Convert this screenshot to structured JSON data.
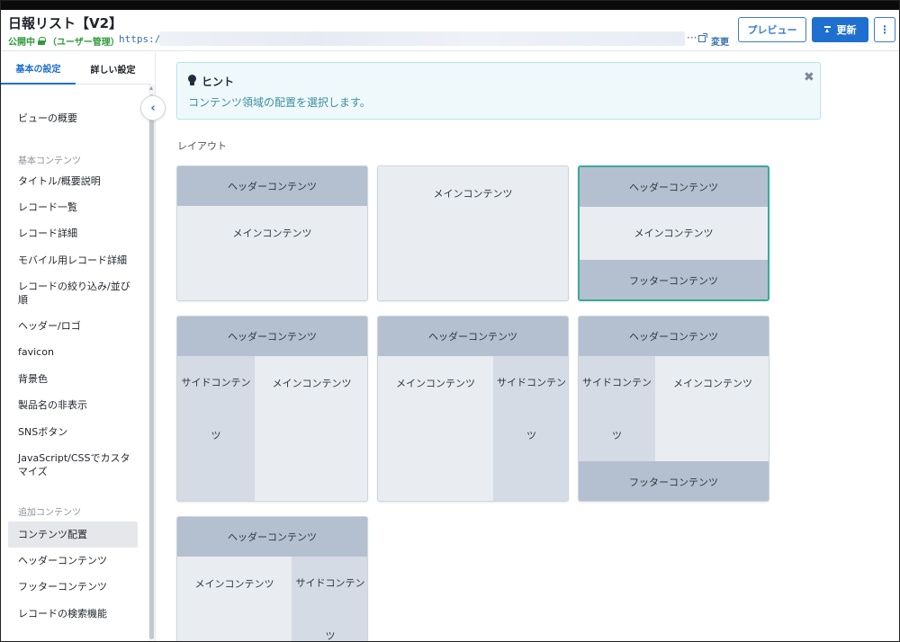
{
  "header": {
    "title": "日報リスト【V2】",
    "status": "公開中",
    "permission": "（ユーザー管理）",
    "url_prefix": "https://",
    "url_ellipsis": "···",
    "change_label": "変更",
    "preview_label": "プレビュー",
    "update_label": "更新",
    "more_label": "⋮"
  },
  "sidebar": {
    "tabs": [
      "基本の設定",
      "詳しい設定"
    ],
    "overview": "ビューの概要",
    "section_basic": "基本コンテンツ",
    "basic_items": [
      "タイトル/概要説明",
      "レコード一覧",
      "レコード詳細",
      "モバイル用レコード詳細",
      "レコードの絞り込み/並び順",
      "ヘッダー/ロゴ",
      "favicon",
      "背景色",
      "製品名の非表示",
      "SNSボタン",
      "JavaScript/CSSでカスタマイズ"
    ],
    "section_extra": "追加コンテンツ",
    "extra_items": [
      "コンテンツ配置",
      "ヘッダーコンテンツ",
      "フッターコンテンツ",
      "レコードの検索機能"
    ],
    "active_item": "コンテンツ配置"
  },
  "hint": {
    "title": "ヒント",
    "text": "コンテンツ領域の配置を選択します。"
  },
  "layout": {
    "label": "レイアウト",
    "header": "ヘッダーコンテンツ",
    "main": "メインコンテンツ",
    "footer": "フッターコンテンツ",
    "side_line1": "サイドコンテン",
    "side_line2": "ツ",
    "selected_option": 3
  },
  "colors": {
    "accent": "#1f6fd1",
    "selected_border": "#3aa999",
    "status_green": "#2e9a3d"
  }
}
